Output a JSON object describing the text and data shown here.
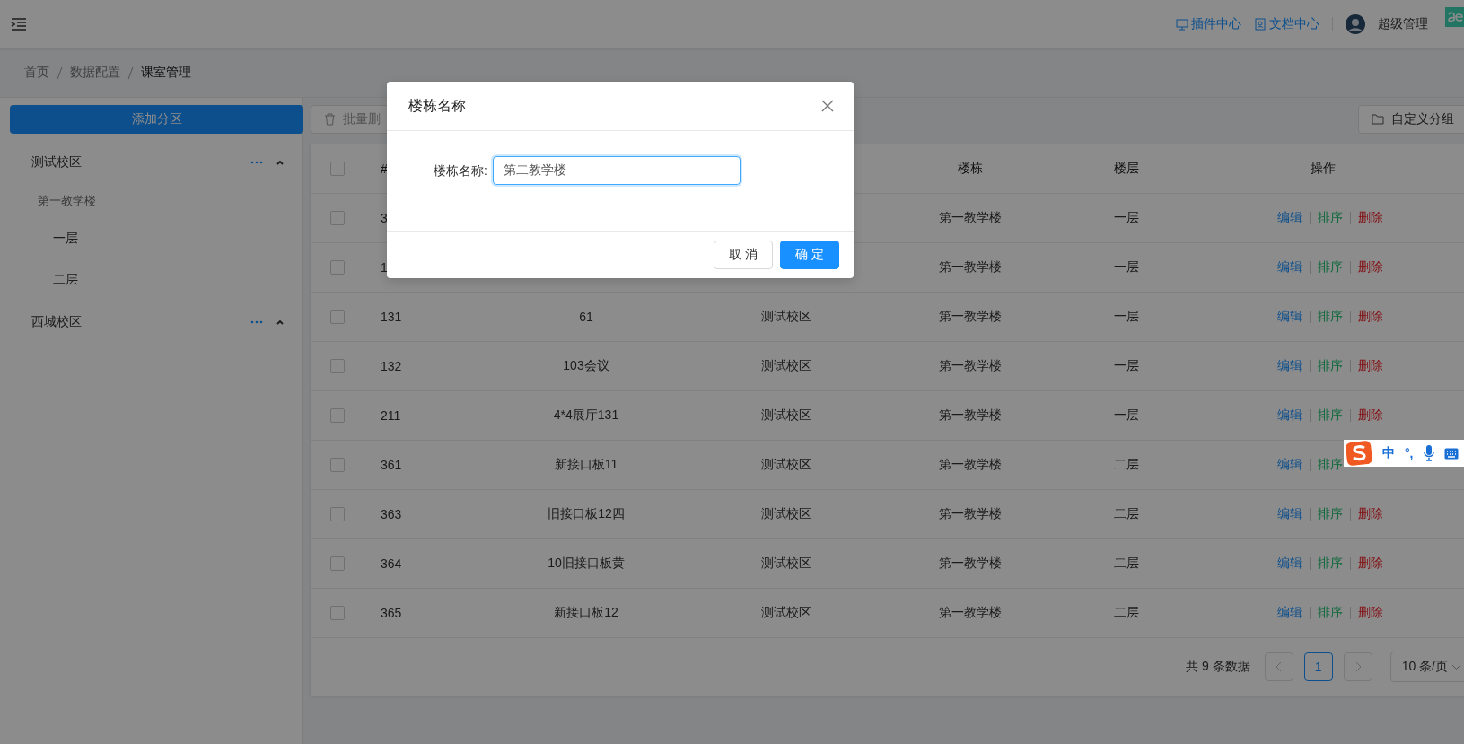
{
  "header": {
    "links": [
      {
        "label": "插件中心",
        "kind": "plugin"
      },
      {
        "label": "文档中心",
        "kind": "docs"
      }
    ],
    "user": "超级管理"
  },
  "breadcrumb": [
    "首页",
    "数据配置",
    "课室管理"
  ],
  "sidebar": {
    "add_button": "添加分区",
    "zones": [
      {
        "label": "测试校区",
        "expanded": true,
        "children": [
          {
            "label": "第一教学楼",
            "children": [
              {
                "label": "一层"
              },
              {
                "label": "二层"
              }
            ]
          }
        ]
      },
      {
        "label": "西城校区",
        "expanded": true
      }
    ]
  },
  "toolbar": {
    "batch_delete": "批量删",
    "custom_group": "自定义分组"
  },
  "table": {
    "header_checked": false,
    "columns": [
      "#",
      "",
      "",
      "楼栋",
      "楼层",
      "操作"
    ],
    "rows": [
      {
        "checked": false,
        "id": "3",
        "name": "",
        "campus": "",
        "building": "第一教学楼",
        "floor": "一层",
        "actions": [
          {
            "kind": "edit",
            "label": "编辑"
          },
          {
            "kind": "sort",
            "label": "排序"
          },
          {
            "kind": "delete",
            "label": "删除"
          }
        ]
      },
      {
        "checked": false,
        "id": "1",
        "name": "",
        "campus": "",
        "building": "第一教学楼",
        "floor": "一层",
        "actions": [
          {
            "kind": "edit",
            "label": "编辑"
          },
          {
            "kind": "sort",
            "label": "排序"
          },
          {
            "kind": "delete",
            "label": "删除"
          }
        ]
      },
      {
        "checked": false,
        "id": "131",
        "name": "61",
        "campus": "测试校区",
        "building": "第一教学楼",
        "floor": "一层",
        "actions": [
          {
            "kind": "edit",
            "label": "编辑"
          },
          {
            "kind": "sort",
            "label": "排序"
          },
          {
            "kind": "delete",
            "label": "删除"
          }
        ]
      },
      {
        "checked": false,
        "id": "132",
        "name": "103会议",
        "campus": "测试校区",
        "building": "第一教学楼",
        "floor": "一层",
        "actions": [
          {
            "kind": "edit",
            "label": "编辑"
          },
          {
            "kind": "sort",
            "label": "排序"
          },
          {
            "kind": "delete",
            "label": "删除"
          }
        ]
      },
      {
        "checked": false,
        "id": "211",
        "name": "4*4展厅131",
        "campus": "测试校区",
        "building": "第一教学楼",
        "floor": "一层",
        "actions": [
          {
            "kind": "edit",
            "label": "编辑"
          },
          {
            "kind": "sort",
            "label": "排序"
          },
          {
            "kind": "delete",
            "label": "删除"
          }
        ]
      },
      {
        "checked": false,
        "id": "361",
        "name": "新接口板11",
        "campus": "测试校区",
        "building": "第一教学楼",
        "floor": "二层",
        "actions": [
          {
            "kind": "edit",
            "label": "编辑"
          },
          {
            "kind": "sort",
            "label": "排序"
          }
        ]
      },
      {
        "checked": false,
        "id": "363",
        "name": "旧接口板12四",
        "campus": "测试校区",
        "building": "第一教学楼",
        "floor": "二层",
        "actions": [
          {
            "kind": "edit",
            "label": "编辑"
          },
          {
            "kind": "sort",
            "label": "排序"
          },
          {
            "kind": "delete",
            "label": "删除"
          }
        ]
      },
      {
        "checked": false,
        "id": "364",
        "name": "10旧接口板黄",
        "campus": "测试校区",
        "building": "第一教学楼",
        "floor": "二层",
        "actions": [
          {
            "kind": "edit",
            "label": "编辑"
          },
          {
            "kind": "sort",
            "label": "排序"
          },
          {
            "kind": "delete",
            "label": "删除"
          }
        ]
      },
      {
        "checked": false,
        "id": "365",
        "name": "新接口板12",
        "campus": "测试校区",
        "building": "第一教学楼",
        "floor": "二层",
        "actions": [
          {
            "kind": "edit",
            "label": "编辑"
          },
          {
            "kind": "sort",
            "label": "排序"
          },
          {
            "kind": "delete",
            "label": "删除"
          }
        ]
      }
    ]
  },
  "pagination": {
    "total": "共 9 条数据",
    "pages": [
      {
        "label": "1",
        "selected": true
      }
    ],
    "page_size": "10 条/页"
  },
  "dialog": {
    "title": "楼栋名称",
    "field_label": "楼栋名称:",
    "value": "第二教学楼",
    "buttons": [
      {
        "label": "取 消",
        "kind": "default"
      },
      {
        "label": "确 定",
        "kind": "primary"
      }
    ]
  },
  "ime_toolbar": {
    "mode": "中",
    "punct": "°,"
  }
}
